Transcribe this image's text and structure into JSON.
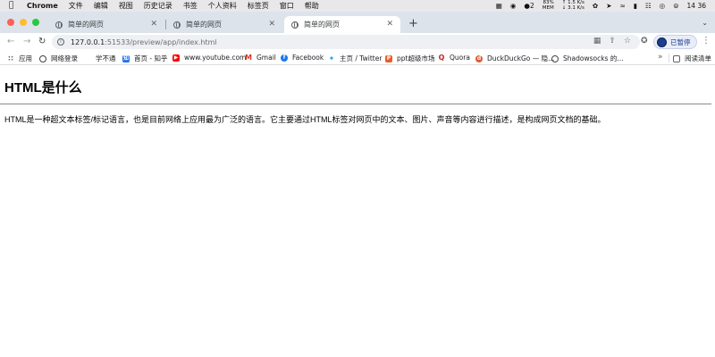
{
  "menubar": {
    "app_name": "Chrome",
    "menus": [
      "文件",
      "编辑",
      "视图",
      "历史记录",
      "书签",
      "个人资料",
      "标签页",
      "窗口",
      "帮助"
    ],
    "status": {
      "notification_count": "2",
      "battery_percent": "83%",
      "battery_sub": "MEM",
      "upload_speed": "↑ 1.5 K/s",
      "download_speed": "↓ 3.1 K/s",
      "clock": "14 36"
    }
  },
  "tabs": [
    {
      "title": "简单的网页",
      "active": false
    },
    {
      "title": "简单的网页",
      "active": false
    },
    {
      "title": "简单的网页",
      "active": true
    }
  ],
  "toolbar": {
    "url_host": "127.0.0.1",
    "url_path": ":51533/preview/app/index.html",
    "profile_label": "已暂停"
  },
  "bookmarks": {
    "items": [
      {
        "label": "应用",
        "icon": "apps-grid-icon"
      },
      {
        "label": "网络登录",
        "icon": "globe-icon"
      },
      {
        "label": "学不通",
        "icon": "none"
      },
      {
        "label": "首页 - 知乎",
        "icon": "zhihu-icon"
      },
      {
        "label": "www.youtube.com",
        "icon": "youtube-icon"
      },
      {
        "label": "Gmail",
        "icon": "gmail-icon"
      },
      {
        "label": "Facebook",
        "icon": "facebook-icon"
      },
      {
        "label": "主页 / Twitter",
        "icon": "twitter-icon"
      },
      {
        "label": "ppt超级市场",
        "icon": "ppt-icon"
      },
      {
        "label": "Quora",
        "icon": "quora-icon"
      },
      {
        "label": "DuckDuckGo — 隐...",
        "icon": "duckduckgo-icon"
      },
      {
        "label": "Shadowsocks 的...",
        "icon": "globe-icon"
      }
    ],
    "more": "»",
    "reading_list": "阅读清单"
  },
  "page": {
    "heading": "HTML是什么",
    "paragraph": "HTML是一种超文本标签/标记语言，也是目前网络上应用最为广泛的语言。它主要通过HTML标签对网页中的文本、图片、声音等内容进行描述，是构成网页文档的基础。"
  },
  "colors": {
    "tabstrip_bg": "#dde3ea",
    "omnibox_bg": "#eef0f3",
    "traffic_red": "#ff5f57",
    "traffic_yellow": "#febc2e",
    "traffic_green": "#28c840"
  }
}
